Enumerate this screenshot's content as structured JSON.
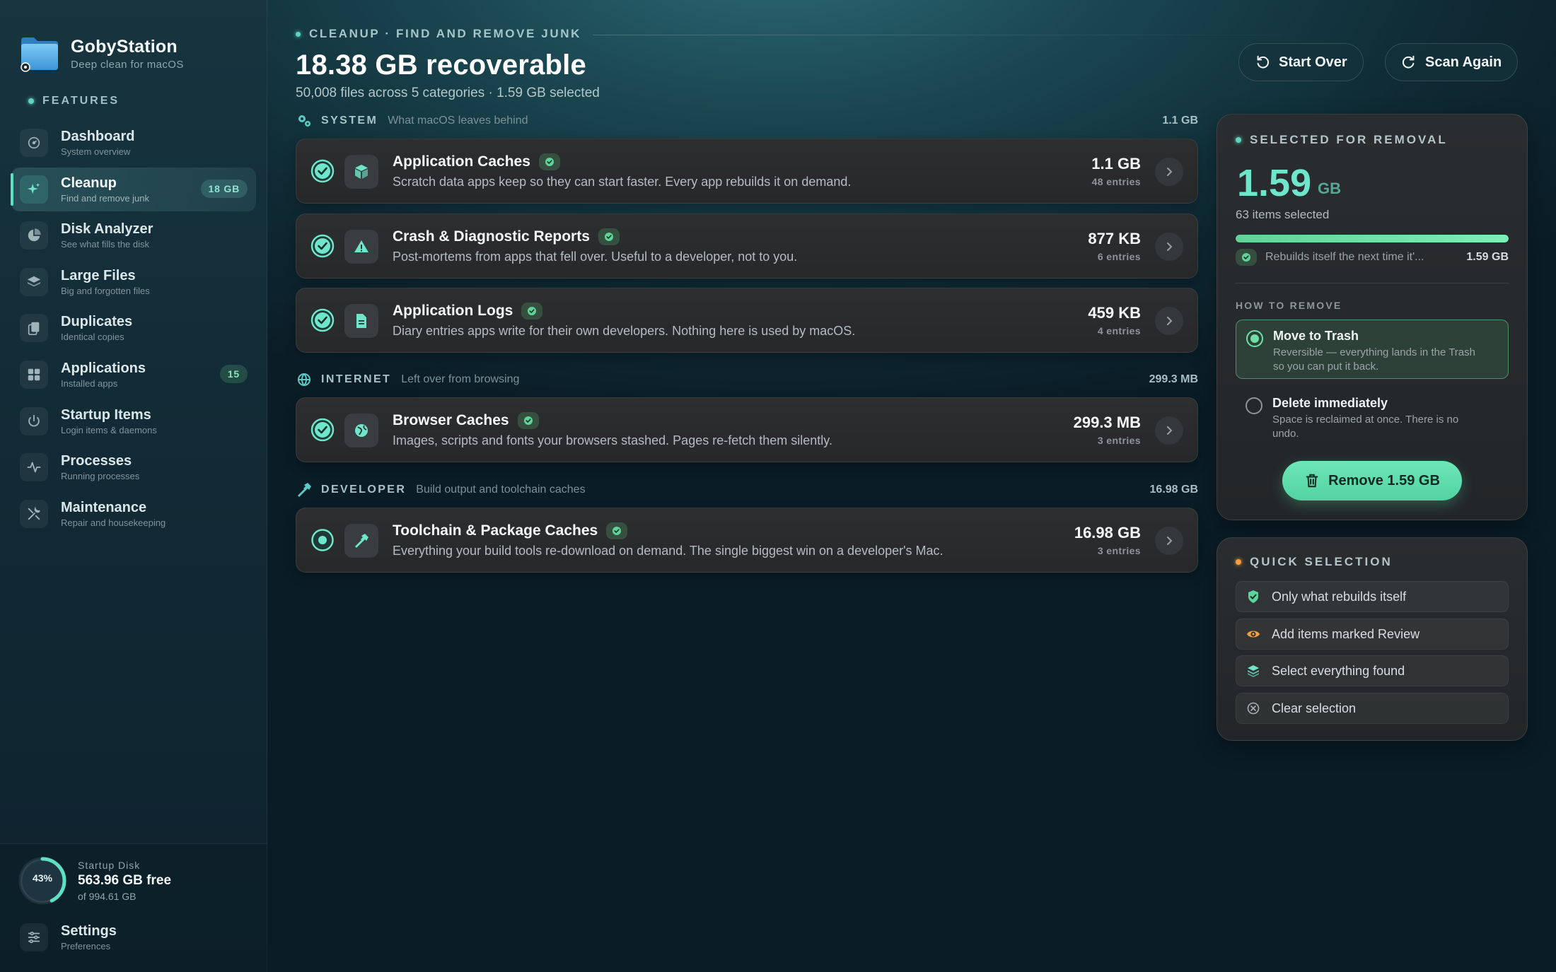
{
  "app": {
    "name": "GobyStation",
    "tagline": "Deep clean for macOS"
  },
  "sidebar": {
    "section_label": "FEATURES",
    "items": [
      {
        "label": "Dashboard",
        "sub": "System overview",
        "icon": "gauge-icon",
        "badge": ""
      },
      {
        "label": "Cleanup",
        "sub": "Find and remove junk",
        "icon": "sparkle-icon",
        "badge": "18 GB",
        "active": true
      },
      {
        "label": "Disk Analyzer",
        "sub": "See what fills the disk",
        "icon": "pie-chart-icon",
        "badge": ""
      },
      {
        "label": "Large Files",
        "sub": "Big and forgotten files",
        "icon": "layers-icon",
        "badge": ""
      },
      {
        "label": "Duplicates",
        "sub": "Identical copies",
        "icon": "copy-icon",
        "badge": ""
      },
      {
        "label": "Applications",
        "sub": "Installed apps",
        "icon": "grid-icon",
        "badge": "15"
      },
      {
        "label": "Startup Items",
        "sub": "Login items & daemons",
        "icon": "power-icon",
        "badge": ""
      },
      {
        "label": "Processes",
        "sub": "Running processes",
        "icon": "activity-icon",
        "badge": ""
      },
      {
        "label": "Maintenance",
        "sub": "Repair and housekeeping",
        "icon": "wrench-icon",
        "badge": ""
      }
    ],
    "disk": {
      "percent_label": "43%",
      "percent_used": 0.43,
      "title": "Startup Disk",
      "free": "563.96 GB free",
      "total": "of 994.61 GB"
    },
    "settings": {
      "label": "Settings",
      "sub": "Preferences"
    }
  },
  "header": {
    "eyebrow": "CLEANUP · FIND AND REMOVE JUNK",
    "title": "18.38 GB recoverable",
    "subtitle": "50,008 files across 5 categories · 1.59 GB selected",
    "start_over": "Start Over",
    "scan_again": "Scan Again"
  },
  "categories": [
    {
      "name": "SYSTEM",
      "desc": "What macOS leaves behind",
      "size": "1.1 GB",
      "rows": [
        {
          "title": "Application Caches",
          "desc": "Scratch data apps keep so they can start faster. Every app rebuilds it on demand.",
          "size": "1.1 GB",
          "entries": "48 entries",
          "checked": true,
          "icon": "box-icon"
        },
        {
          "title": "Crash & Diagnostic Reports",
          "desc": "Post-mortems from apps that fell over. Useful to a developer, not to you.",
          "size": "877 KB",
          "entries": "6 entries",
          "checked": true,
          "icon": "warning-icon"
        },
        {
          "title": "Application Logs",
          "desc": "Diary entries apps write for their own developers. Nothing here is used by macOS.",
          "size": "459 KB",
          "entries": "4 entries",
          "checked": true,
          "icon": "document-icon"
        }
      ]
    },
    {
      "name": "INTERNET",
      "desc": "Left over from browsing",
      "size": "299.3 MB",
      "rows": [
        {
          "title": "Browser Caches",
          "desc": "Images, scripts and fonts your browsers stashed. Pages re-fetch them silently.",
          "size": "299.3 MB",
          "entries": "3 entries",
          "checked": true,
          "icon": "globe-icon"
        }
      ]
    },
    {
      "name": "DEVELOPER",
      "desc": "Build output and toolchain caches",
      "size": "16.98 GB",
      "rows": [
        {
          "title": "Toolchain & Package Caches",
          "desc": "Everything your build tools re-download on demand. The single biggest win on a developer's Mac.",
          "size": "16.98 GB",
          "entries": "3 entries",
          "checked": false,
          "icon": "hammer-icon"
        }
      ]
    }
  ],
  "selection": {
    "label": "SELECTED FOR REMOVAL",
    "amount": "1.59",
    "unit": "GB",
    "items": "63 items selected",
    "progress": 1.0,
    "legend": "Rebuilds itself the next time it'...",
    "legend_size": "1.59 GB",
    "how_label": "HOW TO REMOVE",
    "options": [
      {
        "title": "Move to Trash",
        "desc": "Reversible — everything lands in the Trash so you can put it back.",
        "selected": true
      },
      {
        "title": "Delete immediately",
        "desc": "Space is reclaimed at once. There is no undo.",
        "selected": false
      }
    ],
    "remove_button": "Remove 1.59 GB"
  },
  "quick_selection": {
    "label": "QUICK SELECTION",
    "items": [
      {
        "label": "Only what rebuilds itself",
        "icon": "shield-check-icon"
      },
      {
        "label": "Add items marked Review",
        "icon": "eye-icon"
      },
      {
        "label": "Select everything found",
        "icon": "stack-icon"
      },
      {
        "label": "Clear selection",
        "icon": "x-circle-icon"
      }
    ]
  },
  "colors": {
    "accent": "#6fe6cb",
    "safe_green": "#6fe0a6",
    "review_orange": "#f0a040"
  }
}
